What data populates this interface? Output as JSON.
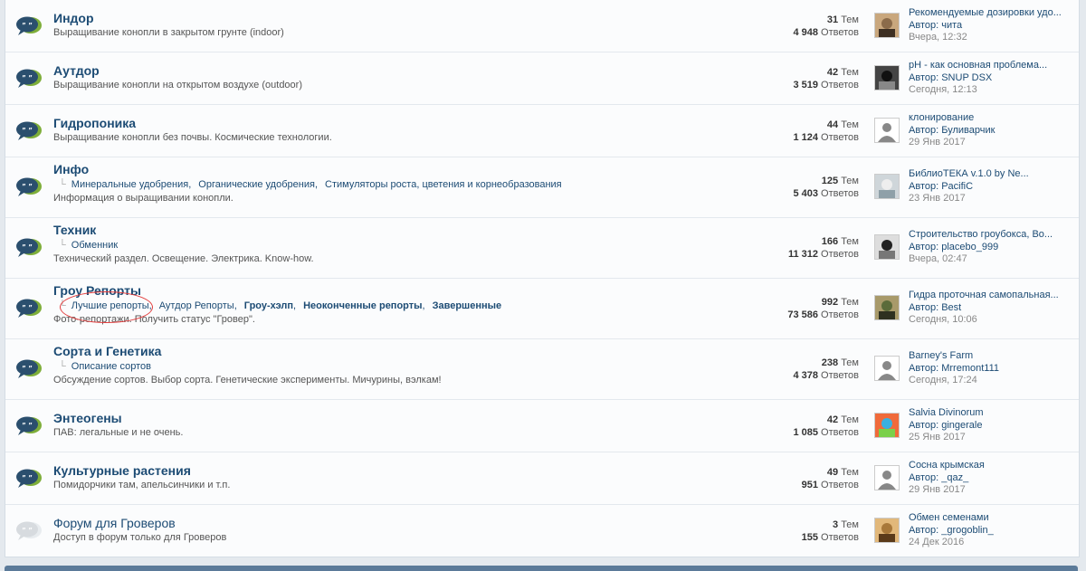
{
  "forums": [
    {
      "title": "Индор",
      "desc": "Выращивание конопли в закрытом грунте (indoor)",
      "subs": [],
      "topics": "31",
      "topics_label": "Тем",
      "posts": "4 948",
      "posts_label": "Ответов",
      "last_title": "Рекомендуемые дозировки удо...",
      "last_author_prefix": "Автор:",
      "last_author": "чита",
      "last_date": "Вчера, 12:32",
      "avatar": "photo-brown",
      "read": false
    },
    {
      "title": "Аутдор",
      "desc": "Выращивание конопли на открытом воздухе (outdoor)",
      "subs": [],
      "topics": "42",
      "topics_label": "Тем",
      "posts": "3 519",
      "posts_label": "Ответов",
      "last_title": "pH - как основная проблема...",
      "last_author_prefix": "Автор:",
      "last_author": "SNUP DSX",
      "last_date": "Сегодня, 12:13",
      "avatar": "photo-dark",
      "read": false
    },
    {
      "title": "Гидропоника",
      "desc": "Выращивание конопли без почвы. Космические технологии.",
      "subs": [],
      "topics": "44",
      "topics_label": "Тем",
      "posts": "1 124",
      "posts_label": "Ответов",
      "last_title": "клонирование",
      "last_author_prefix": "Автор:",
      "last_author": "Буливарчик",
      "last_date": "29 Янв 2017",
      "avatar": "default",
      "read": false
    },
    {
      "title": "Инфо",
      "desc": "Информация о выращивании конопли.",
      "subs": [
        {
          "label": "Минеральные удобрения",
          "bold": false,
          "comma": true
        },
        {
          "label": "Органические удобрения",
          "bold": false,
          "comma": true
        },
        {
          "label": "Стимуляторы роста, цветения и корнеобразования",
          "bold": false,
          "comma": false
        }
      ],
      "topics": "125",
      "topics_label": "Тем",
      "posts": "5 403",
      "posts_label": "Ответов",
      "last_title": "БиблиоТЕКА v.1.0 by Ne...",
      "last_author_prefix": "Автор:",
      "last_author": "PacifiC",
      "last_date": "23 Янв 2017",
      "avatar": "photo-light",
      "read": false
    },
    {
      "title": "Техник",
      "desc": "Технический раздел. Освещение. Электрика. Know-how.",
      "subs": [
        {
          "label": "Обменник",
          "bold": false,
          "comma": false
        }
      ],
      "topics": "166",
      "topics_label": "Тем",
      "posts": "11 312",
      "posts_label": "Ответов",
      "last_title": "Строительство гроубокса, Во...",
      "last_author_prefix": "Автор:",
      "last_author": "placebo_999",
      "last_date": "Вчера, 02:47",
      "avatar": "photo-bw",
      "read": false
    },
    {
      "title": "Гроу Репорты",
      "desc": "Фото-репортажи. Получить статус \"Гровер\".",
      "subs": [
        {
          "label": "Лучшие репорты",
          "bold": false,
          "comma": true
        },
        {
          "label": "Аутдор Репорты",
          "bold": false,
          "comma": true
        },
        {
          "label": "Гроу-хэлп",
          "bold": true,
          "comma": true
        },
        {
          "label": "Неоконченные репорты",
          "bold": true,
          "comma": true
        },
        {
          "label": "Завершенные",
          "bold": true,
          "comma": false
        }
      ],
      "topics": "992",
      "topics_label": "Тем",
      "posts": "73 586",
      "posts_label": "Ответов",
      "last_title": "Гидра проточная самопальная...",
      "last_author_prefix": "Автор:",
      "last_author": "Best",
      "last_date": "Сегодня, 10:06",
      "avatar": "photo-green",
      "read": false
    },
    {
      "title": "Сорта и Генетика",
      "desc": "Обсуждение сортов. Выбор сорта. Генетические эксперименты. Мичурины, вэлкам!",
      "subs": [
        {
          "label": "Описание сортов",
          "bold": false,
          "comma": false
        }
      ],
      "topics": "238",
      "topics_label": "Тем",
      "posts": "4 378",
      "posts_label": "Ответов",
      "last_title": "Barney's Farm",
      "last_author_prefix": "Автор:",
      "last_author": "Mrremont111",
      "last_date": "Сегодня, 17:24",
      "avatar": "default",
      "read": false
    },
    {
      "title": "Энтеогены",
      "desc": "ПАВ: легальные и не очень.",
      "subs": [],
      "topics": "42",
      "topics_label": "Тем",
      "posts": "1 085",
      "posts_label": "Ответов",
      "last_title": "Salvia Divinorum",
      "last_author_prefix": "Автор:",
      "last_author": "gingerale",
      "last_date": "25 Янв 2017",
      "avatar": "photo-color",
      "read": false
    },
    {
      "title": "Культурные растения",
      "desc": "Помидорчики там, апельсинчики и т.п.",
      "subs": [],
      "topics": "49",
      "topics_label": "Тем",
      "posts": "951",
      "posts_label": "Ответов",
      "last_title": "Сосна крымская",
      "last_author_prefix": "Автор:",
      "last_author": "_qaz_",
      "last_date": "29 Янв 2017",
      "avatar": "default",
      "read": false
    },
    {
      "title": "Форум для Гроверов",
      "desc": "Доступ в форум только для Гроверов",
      "subs": [],
      "topics": "3",
      "topics_label": "Тем",
      "posts": "155",
      "posts_label": "Ответов",
      "last_title": "Обмен семенами",
      "last_author_prefix": "Автор:",
      "last_author": "_grogoblin_",
      "last_date": "24 Дек 2016",
      "avatar": "photo-face",
      "read": true
    }
  ],
  "colors": {
    "link": "#1c4b74",
    "icon_unread": "#2b4f6e",
    "icon_read": "#d7dbdf",
    "annotation": "#e23b3b"
  }
}
